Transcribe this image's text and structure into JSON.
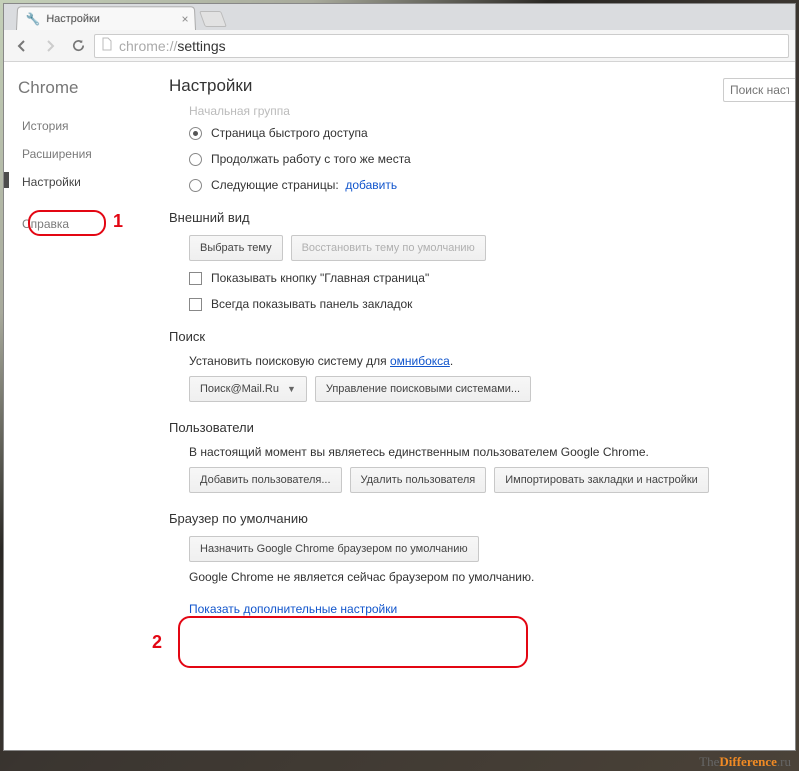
{
  "tab": {
    "title": "Настройки",
    "icon_name": "wrench-icon"
  },
  "toolbar": {
    "url_prefix": "chrome://",
    "url_path": "settings"
  },
  "sidebar": {
    "brand": "Chrome",
    "items": [
      {
        "label": "История"
      },
      {
        "label": "Расширения"
      },
      {
        "label": "Настройки",
        "active": true
      },
      {
        "label": "Справка"
      }
    ]
  },
  "annotations": {
    "num1": "1",
    "num2": "2"
  },
  "settings": {
    "heading": "Настройки",
    "search_placeholder": "Поиск настр",
    "startup": {
      "title_faded": "Начальная группа",
      "opt_fast": "Страница быстрого доступа",
      "opt_continue": "Продолжать работу с того же места",
      "opt_pages": "Следующие страницы:",
      "opt_pages_link": "добавить"
    },
    "appearance": {
      "title": "Внешний вид",
      "btn_choose_theme": "Выбрать тему",
      "btn_reset_theme": "Восстановить тему по умолчанию",
      "chk_home": "Показывать кнопку \"Главная страница\"",
      "chk_bookmarks": "Всегда показывать панель закладок"
    },
    "search": {
      "title": "Поиск",
      "desc_prefix": "Установить поисковую систему для ",
      "desc_link": "омнибокса",
      "desc_suffix": ".",
      "dropdown": "Поиск@Mail.Ru",
      "btn_manage": "Управление поисковыми системами..."
    },
    "users": {
      "title": "Пользователи",
      "desc": "В настоящий момент вы являетесь единственным пользователем Google Chrome.",
      "btn_add": "Добавить пользователя...",
      "btn_delete": "Удалить пользователя",
      "btn_import": "Импортировать закладки и настройки"
    },
    "default_browser": {
      "title": "Браузер по умолчанию",
      "btn_set": "Назначить Google Chrome браузером по умолчанию",
      "note": "Google Chrome не является сейчас браузером по умолчанию."
    },
    "show_more": "Показать дополнительные настройки"
  },
  "watermark": {
    "prefix": "The",
    "hl": "Difference",
    "suffix": ".ru"
  }
}
